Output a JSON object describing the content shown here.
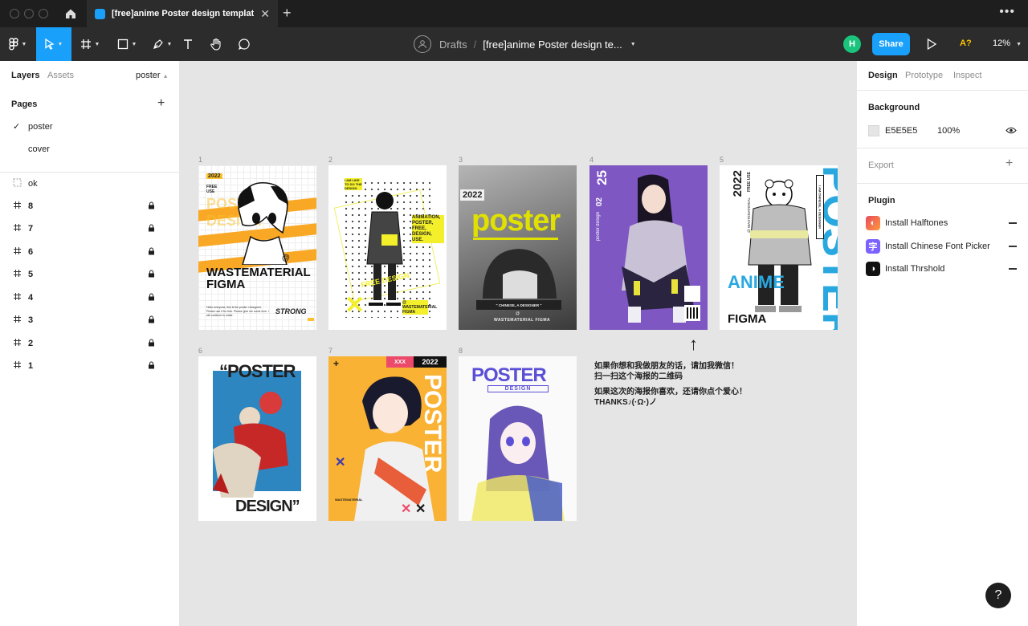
{
  "titlebar": {
    "tab_title": "[free]anime Poster design template ..."
  },
  "toolbar": {
    "breadcrumb_drafts": "Drafts",
    "breadcrumb_separator": "/",
    "file_name": "[free]anime Poster design te...",
    "user_initial": "H",
    "share_label": "Share",
    "font_warning": "A?",
    "zoom": "12%"
  },
  "left_panel": {
    "tab_layers": "Layers",
    "tab_assets": "Assets",
    "page_selector": "poster",
    "pages_heading": "Pages",
    "pages": [
      "poster",
      "cover"
    ],
    "layers": [
      {
        "name": "ok",
        "type": "group",
        "locked": false
      },
      {
        "name": "8",
        "type": "frame",
        "locked": true
      },
      {
        "name": "7",
        "type": "frame",
        "locked": true
      },
      {
        "name": "6",
        "type": "frame",
        "locked": true
      },
      {
        "name": "5",
        "type": "frame",
        "locked": true
      },
      {
        "name": "4",
        "type": "frame",
        "locked": true
      },
      {
        "name": "3",
        "type": "frame",
        "locked": true
      },
      {
        "name": "2",
        "type": "frame",
        "locked": true
      },
      {
        "name": "1",
        "type": "frame",
        "locked": true
      }
    ]
  },
  "right_panel": {
    "tab_design": "Design",
    "tab_prototype": "Prototype",
    "tab_inspect": "Inspect",
    "background_heading": "Background",
    "background_hex": "E5E5E5",
    "background_opacity": "100%",
    "export_heading": "Export",
    "plugin_heading": "Plugin",
    "plugins": [
      "Install Halftones",
      "Install Chinese Font Picker",
      "Install Thrshold"
    ]
  },
  "canvas": {
    "frame_labels": [
      "1",
      "2",
      "3",
      "4",
      "5",
      "6",
      "7",
      "8"
    ],
    "poster1": {
      "year": "2022",
      "free_use": "FREE USE",
      "title": "WASTEMATERIAL FIGMA",
      "tagline": "STRONG",
      "bg_text": "POSTER DESIGN",
      "at": "@",
      "body": "Hello everyone, this is the poster i designed. Please use it for free. Please give me some love. I will continue to make."
    },
    "poster2": {
      "side_text": "ANIMATION, POSTER, FREE, DESIGN, USE.",
      "credit": "@ WASTEMATERIAL FIGMA",
      "small_text": "I AM LIKE TO DO THE DESIGN",
      "tag": "FREE DESIGN"
    },
    "poster3": {
      "year": "2022",
      "title": "poster",
      "subtitle": "\" CHINESE, A DESIGNER \"",
      "at": "@",
      "credit": "WASTEMATERIAL FIGMA"
    },
    "poster4": {
      "day": "25",
      "month": "02",
      "label": "poster design"
    },
    "poster5": {
      "year": "2022",
      "free_use": "FREE USE",
      "credit": "@ WASTEMATERIAL",
      "big": "POSTER",
      "anime": "ANIME",
      "figma": "FIGMA",
      "tag": "I AM CHINESE, A DESIGNER"
    },
    "poster6": {
      "top": "“POSTER",
      "bottom": "DESIGN”"
    },
    "poster7": {
      "year": "2022",
      "xxx": "XXX",
      "side": "POSTER",
      "plus": "+",
      "credit": "WASTEMATERIAL"
    },
    "poster8": {
      "title": "POSTER",
      "subtitle": "DESIGN"
    },
    "arrow": "↑",
    "note_lines": [
      "如果你想和我做朋友的话，请加我微信！",
      "扫一扫这个海报的二维码",
      "如果这次的海报你喜欢，还请你点个爱心！",
      "THANKS♪(·Ω·)ノ"
    ]
  },
  "help": "?",
  "colors": {
    "accent": "#18a0fb",
    "titlebar": "#1e1e1e",
    "toolbar": "#2c2c2c",
    "canvas": "#e5e5e5",
    "user_avatar": "#1bc47d"
  }
}
